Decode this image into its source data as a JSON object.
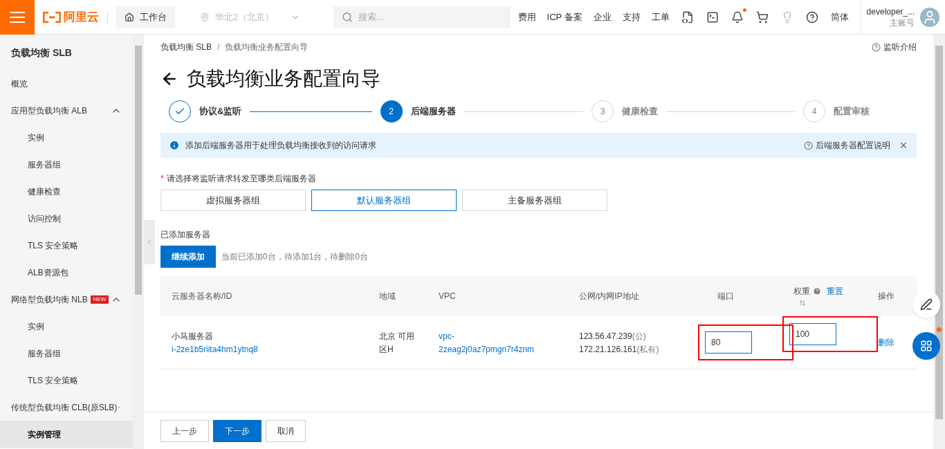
{
  "topbar": {
    "logo": "阿里云",
    "workbench": "工作台",
    "region": "华北2（北京）",
    "search": {
      "placeholder": "搜索..."
    },
    "links": [
      "费用",
      "ICP 备案",
      "企业",
      "支持",
      "工单"
    ],
    "language": "简体",
    "user": {
      "name": "developer_...",
      "role": "主账号"
    }
  },
  "sidebar": {
    "title": "负载均衡 SLB",
    "items": [
      {
        "label": "概览"
      },
      {
        "label": "应用型负载均衡 ALB",
        "expanded": true,
        "children": [
          {
            "label": "实例",
            "selected": false
          },
          {
            "label": "服务器组",
            "selected": false
          },
          {
            "label": "健康检查",
            "selected": false
          },
          {
            "label": "访问控制",
            "selected": false
          },
          {
            "label": "TLS 安全策略",
            "selected": false
          },
          {
            "label": "ALB资源包",
            "selected": false
          }
        ]
      },
      {
        "label": "网络型负载均衡 NLB",
        "badge": "NEW",
        "expanded": true,
        "children": [
          {
            "label": "实例",
            "selected": false
          },
          {
            "label": "服务器组",
            "selected": false
          },
          {
            "label": "TLS 安全策略",
            "selected": false
          }
        ]
      },
      {
        "label": "传统型负载均衡 CLB(原SLB)",
        "expanded": true,
        "children": [
          {
            "label": "实例管理",
            "selected": true
          }
        ]
      }
    ]
  },
  "breadcrumb": [
    "负载均衡 SLB",
    "/",
    "负载均衡业务配置向导"
  ],
  "help_link": "监听介绍",
  "title": "负载均衡业务配置向导",
  "steps": [
    {
      "label": "协议&监听",
      "completed": true,
      "selected": false
    },
    {
      "number": "2",
      "label": "后端服务器",
      "completed": false,
      "selected": true
    },
    {
      "number": "3",
      "label": "健康检查",
      "completed": false,
      "selected": false
    },
    {
      "number": "4",
      "label": "配置审核",
      "completed": false,
      "selected": false
    }
  ],
  "notice": {
    "text": "添加后端服务器用于处理负载均衡接收到的访问请求",
    "link": "后端服务器配置说明"
  },
  "server_type": {
    "required_mark": "*",
    "label": "请选择将监听请求转发至哪类后端服务器",
    "options": [
      {
        "label": "虚拟服务器组",
        "selected": false
      },
      {
        "label": "默认服务器组",
        "selected": true
      },
      {
        "label": "主备服务器组",
        "selected": false
      }
    ]
  },
  "added": {
    "label": "已添加服务器",
    "button": "继续添加",
    "summary": "当前已添加0台，待添加1台，待删除0台"
  },
  "table": {
    "columns": [
      "云服务器名称/ID",
      "地域",
      "VPC",
      "公网/内网IP地址",
      "端口",
      "权重",
      "操作"
    ],
    "reset": "重置",
    "rows": [
      {
        "name": "小马服务器",
        "id": "i-2ze1b5riita4hm1ytnq8",
        "region": [
          "北京 可用",
          "区H"
        ],
        "vpc": [
          "vpc-",
          "2zeag2j0az7pmgn7r4znm"
        ],
        "ips": [
          {
            "ip": "123.56.47.239",
            "kind": "(公)"
          },
          {
            "ip": "172.21.126.161",
            "kind": "(私有)"
          }
        ],
        "port": {
          "value": "80",
          "highlighted": true
        },
        "weight": {
          "value": "100",
          "highlighted": true
        },
        "action": "删除"
      }
    ]
  },
  "footer": {
    "buttons": [
      {
        "label": "上一步",
        "primary": false
      },
      {
        "label": "下一步",
        "primary": true
      },
      {
        "label": "取消",
        "primary": false
      }
    ]
  }
}
